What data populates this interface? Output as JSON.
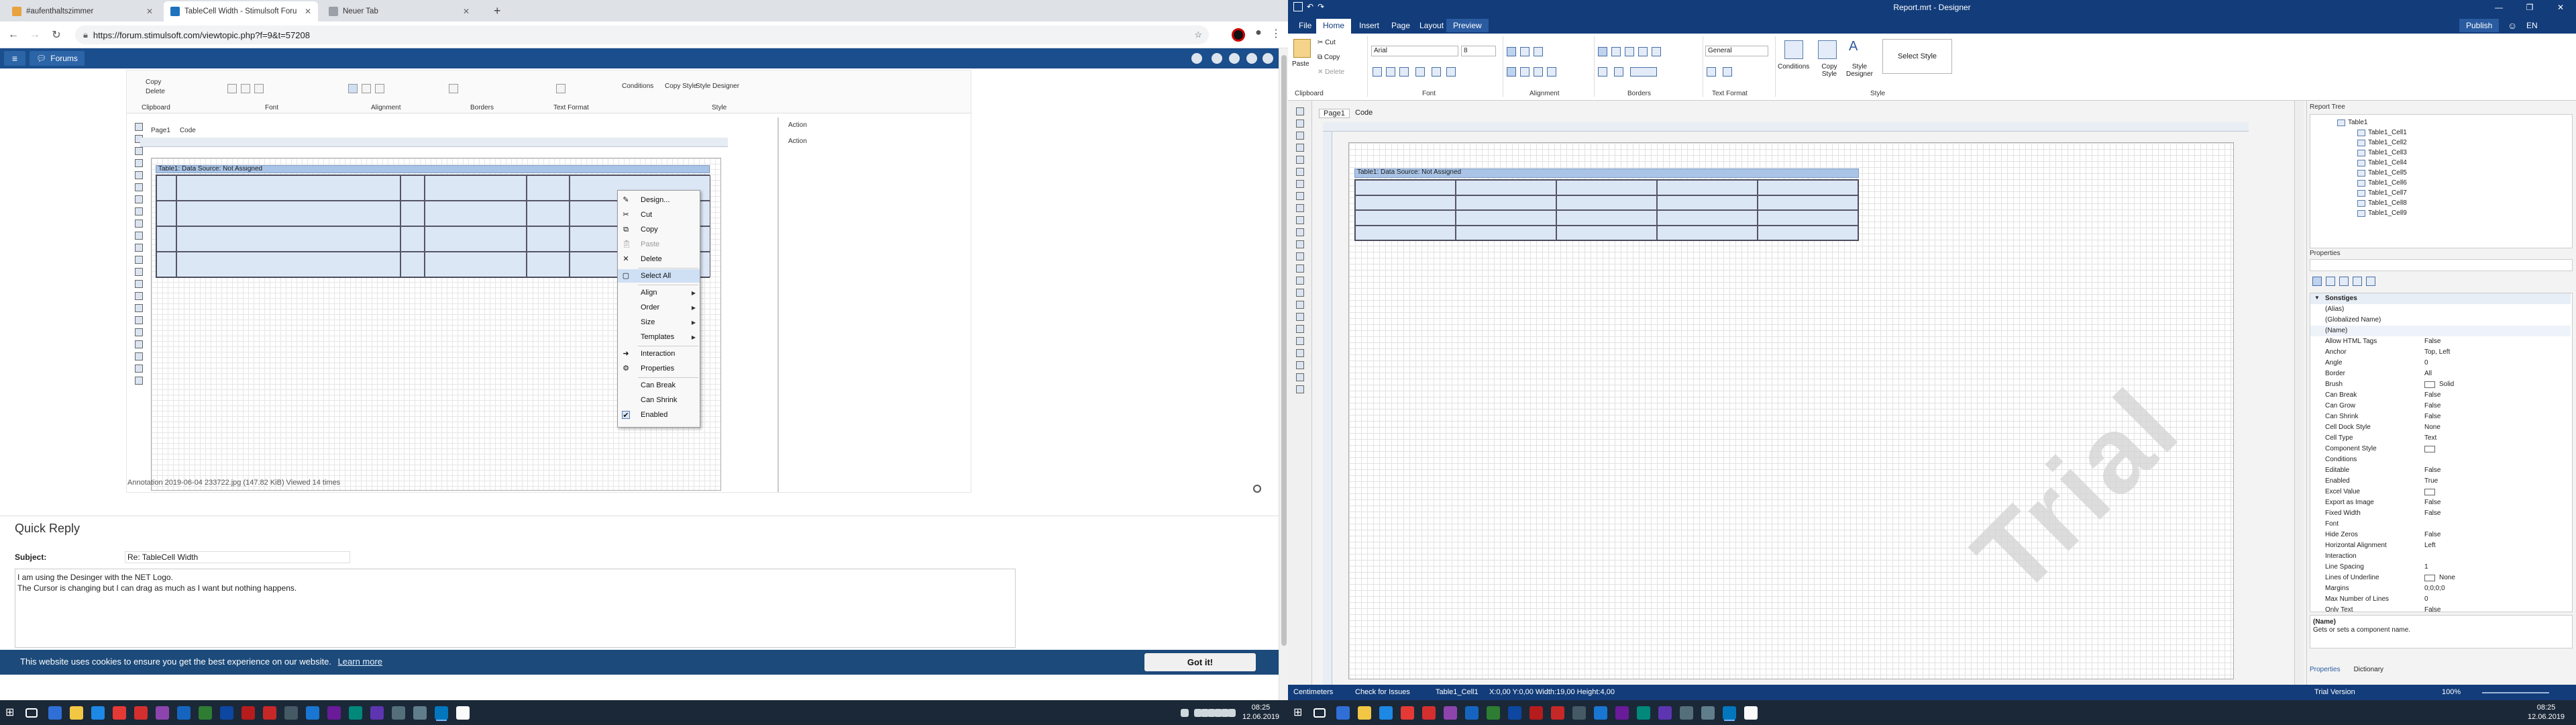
{
  "browser": {
    "tabs": [
      {
        "label": "#aufenthaltszimmer",
        "color": "#e8a33d"
      },
      {
        "label": "TableCell Width - Stimulsoft Foru",
        "color": "#1e73be"
      },
      {
        "label": "Neuer Tab",
        "color": "#9aa0a6"
      }
    ],
    "new_tab": "+",
    "url": "https://forum.stimulsoft.com/viewtopic.php?f=9&t=57208"
  },
  "forum": {
    "menu_icon": "≡",
    "forums_label": "Forums",
    "attachment": {
      "ribbon_groups": [
        "Clipboard",
        "Font",
        "Alignment",
        "Borders",
        "Text Format",
        "Style"
      ],
      "ribbon_items": [
        "Copy",
        "Delete",
        "Conditions",
        "Copy Style",
        "Style Designer"
      ],
      "page_tab": "Page1",
      "code_tab": "Code",
      "table_header": "Table1: Data Source: Not Assigned",
      "side_labels": [
        "Action",
        "Action"
      ],
      "context_menu": [
        {
          "label": "Design...",
          "icon": "pencil-icon",
          "enabled": true,
          "submenu": false,
          "highlight": false,
          "checked": false
        },
        {
          "label": "Cut",
          "icon": "scissors-icon",
          "enabled": true,
          "submenu": false,
          "highlight": false,
          "checked": false
        },
        {
          "label": "Copy",
          "icon": "copy-icon",
          "enabled": true,
          "submenu": false,
          "highlight": false,
          "checked": false
        },
        {
          "label": "Paste",
          "icon": "paste-icon",
          "enabled": false,
          "submenu": false,
          "highlight": false,
          "checked": false
        },
        {
          "label": "Delete",
          "icon": "delete-icon",
          "enabled": true,
          "submenu": false,
          "highlight": false,
          "checked": false
        },
        {
          "label": "Select All",
          "icon": "select-all-icon",
          "enabled": true,
          "submenu": false,
          "highlight": true,
          "checked": false
        },
        {
          "label": "Align",
          "icon": "",
          "enabled": true,
          "submenu": true,
          "highlight": false,
          "checked": false
        },
        {
          "label": "Order",
          "icon": "",
          "enabled": true,
          "submenu": true,
          "highlight": false,
          "checked": false
        },
        {
          "label": "Size",
          "icon": "",
          "enabled": true,
          "submenu": true,
          "highlight": false,
          "checked": false
        },
        {
          "label": "Templates",
          "icon": "",
          "enabled": true,
          "submenu": true,
          "highlight": false,
          "checked": false
        },
        {
          "label": "Interaction",
          "icon": "interaction-icon",
          "enabled": true,
          "submenu": false,
          "highlight": false,
          "checked": false
        },
        {
          "label": "Properties",
          "icon": "properties-icon",
          "enabled": true,
          "submenu": false,
          "highlight": false,
          "checked": false
        },
        {
          "label": "Can Break",
          "icon": "",
          "enabled": true,
          "submenu": false,
          "highlight": false,
          "checked": false
        },
        {
          "label": "Can Shrink",
          "icon": "",
          "enabled": true,
          "submenu": false,
          "highlight": false,
          "checked": false
        },
        {
          "label": "Enabled",
          "icon": "check-icon",
          "enabled": true,
          "submenu": false,
          "highlight": false,
          "checked": true
        }
      ],
      "caption": "Annotation 2019-06-04 233722.jpg (147.82 KiB) Viewed 14 times"
    },
    "quick_reply": {
      "heading": "Quick Reply",
      "subject_label": "Subject:",
      "subject_value": "Re: TableCell Width",
      "body_lines": [
        "I am using the Desinger with the NET Logo.",
        "The Cursor is changing but I can drag as much as I want but nothing happens."
      ]
    },
    "cookie": {
      "text": "This website uses cookies to ensure you get the best experience on our website.",
      "link": "Learn more",
      "button": "Got it!"
    }
  },
  "designer": {
    "title": "Report.mrt - Designer",
    "window_controls": [
      "—",
      "❐",
      "✕"
    ],
    "menu": [
      "File",
      "Home",
      "Insert",
      "Page",
      "Layout",
      "Preview"
    ],
    "active_menu": "Home",
    "publish": "Publish",
    "lang": "EN",
    "ribbon": {
      "paste": "Paste",
      "cut": "Cut",
      "copy": "Copy",
      "delete": "Delete",
      "font_name": "Arial",
      "font_size": "8",
      "format": "General",
      "conditions": "Conditions",
      "copy_style": "Copy Style",
      "style_designer": "Style Designer",
      "select_style": "Select Style",
      "groups": [
        "Clipboard",
        "Font",
        "Alignment",
        "Borders",
        "Text Format",
        "Style"
      ]
    },
    "page_tab": "Page1",
    "code_tab": "Code",
    "table_header": "Table1: Data Source: Not Assigned",
    "watermark": "Trial",
    "report_tree": {
      "title": "Report Tree",
      "items": [
        "Table1",
        "Table1_Cell1",
        "Table1_Cell2",
        "Table1_Cell3",
        "Table1_Cell4",
        "Table1_Cell5",
        "Table1_Cell6",
        "Table1_Cell7",
        "Table1_Cell8",
        "Table1_Cell9"
      ]
    },
    "properties": {
      "title": "Properties",
      "category": "Sonstiges",
      "rows": [
        {
          "k": "(Alias)",
          "v": ""
        },
        {
          "k": "(Globalized Name)",
          "v": ""
        },
        {
          "k": "(Name)",
          "v": ""
        },
        {
          "k": "Allow HTML Tags",
          "v": "False"
        },
        {
          "k": "Anchor",
          "v": "Top, Left"
        },
        {
          "k": "Angle",
          "v": "0"
        },
        {
          "k": "Border",
          "v": "All"
        },
        {
          "k": "Brush",
          "v": "Solid"
        },
        {
          "k": "Can Break",
          "v": "False"
        },
        {
          "k": "Can Grow",
          "v": "False"
        },
        {
          "k": "Can Shrink",
          "v": "False"
        },
        {
          "k": "Cell Dock Style",
          "v": "None"
        },
        {
          "k": "Cell Type",
          "v": "Text"
        },
        {
          "k": "Component Style",
          "v": ""
        },
        {
          "k": "Conditions",
          "v": ""
        },
        {
          "k": "Editable",
          "v": "False"
        },
        {
          "k": "Enabled",
          "v": "True"
        },
        {
          "k": "Excel Value",
          "v": ""
        },
        {
          "k": "Export as Image",
          "v": "False"
        },
        {
          "k": "Fixed Width",
          "v": "False"
        },
        {
          "k": "Font",
          "v": ""
        },
        {
          "k": "Hide Zeros",
          "v": "False"
        },
        {
          "k": "Horizontal Alignment",
          "v": "Left"
        },
        {
          "k": "Interaction",
          "v": ""
        },
        {
          "k": "Line Spacing",
          "v": "1"
        },
        {
          "k": "Lines of Underline",
          "v": "None"
        },
        {
          "k": "Margins",
          "v": "0;0;0;0"
        },
        {
          "k": "Max Number of Lines",
          "v": "0"
        },
        {
          "k": "Only Text",
          "v": "False"
        }
      ],
      "desc_name": "(Name)",
      "desc_text": "Gets or sets a component name.",
      "tabs": [
        "Properties",
        "Dictionary"
      ]
    },
    "status": {
      "units": "Centimeters",
      "check": "Check for Issues",
      "component": "Table1_Cell1",
      "coords": "X:0,00 Y:0,00 Width:19,00 Height:4,00",
      "trial": "Trial Version",
      "zoom": "100%"
    }
  },
  "taskbar": {
    "time": "08:25",
    "date": "12.06.2019",
    "icons": [
      "#2f6fd6",
      "#f2c744",
      "#1e88e5",
      "#e53935",
      "#d32f2f",
      "#8e44ad",
      "#1565c0",
      "#2e7d32",
      "#0d47a1",
      "#b71c1c",
      "#c62828",
      "#455a64",
      "#1976d2",
      "#6a1b9a",
      "#00897b",
      "#5e35b1",
      "#546e7a",
      "#607d8b",
      "#0277bd",
      "#fafafa"
    ]
  }
}
